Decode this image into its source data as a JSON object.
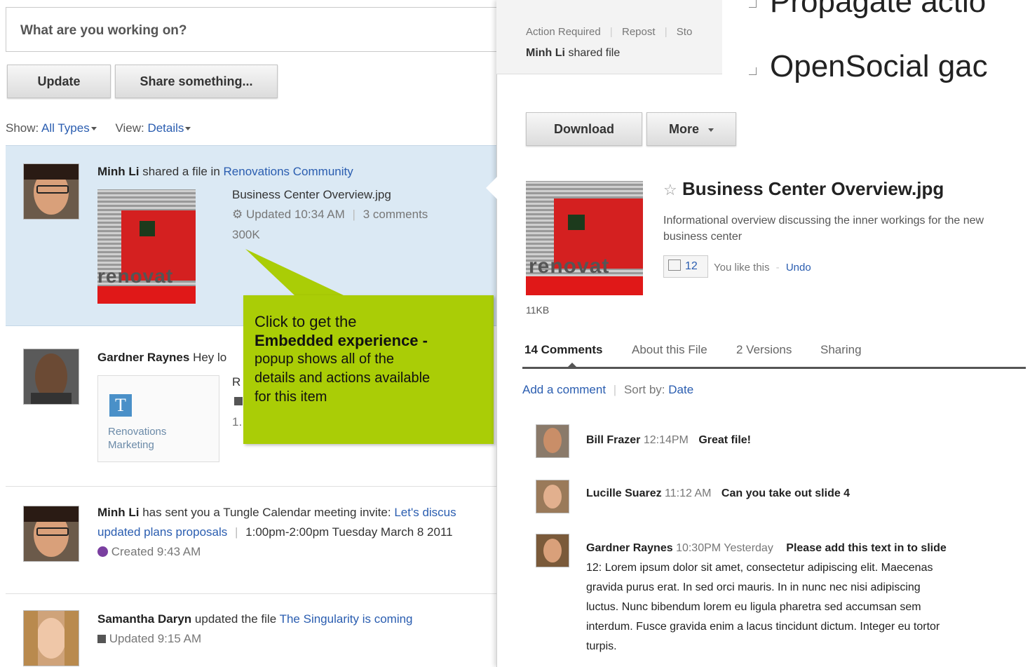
{
  "status": {
    "placeholder": "What are you working on?"
  },
  "buttons": {
    "update": "Update",
    "share": "Share something..."
  },
  "filter": {
    "show_label": "Show:",
    "show_value": "All Types",
    "view_label": "View:",
    "view_value": "Details"
  },
  "feed": {
    "item1": {
      "author": "Minh Li",
      "action": "shared a file in",
      "community": "Renovations Community",
      "file": "Business Center Overview.jpg",
      "updated": "Updated 10:34 AM",
      "comments": "3 comments",
      "size": "300K"
    },
    "item2": {
      "author": "Gardner Raynes",
      "text": "Hey lo",
      "title_frag": "R",
      "size_frag": "1.",
      "card_line1": "Renovations",
      "card_line2": "Marketing"
    },
    "item3": {
      "author": "Minh Li",
      "text": "has sent you a Tungle Calendar meeting invite:",
      "link1": "Let's discus",
      "link2": "updated plans proposals",
      "time": "1:00pm-2:00pm Tuesday March 8 2011",
      "created": "Created 9:43 AM"
    },
    "item4": {
      "author": "Samantha Daryn",
      "action": "updated the file",
      "link": "The Singularity is coming",
      "updated": "Updated 9:15 AM"
    }
  },
  "callout": {
    "line1": "Click to get the",
    "bold": "Embedded experience -",
    "line3": "popup shows all of the",
    "line4": "details and actions available",
    "line5": "for this item"
  },
  "panel": {
    "head_links": [
      "Action Required",
      "Repost",
      "Sto"
    ],
    "head_author": "Minh Li",
    "head_action": "shared file",
    "download": "Download",
    "more": "More",
    "title": "Business Center Overview.jpg",
    "description": "Informational overview discussing the inner workings for the new business center",
    "likes": "12",
    "you_like": "You like this",
    "undo": "Undo",
    "size": "11KB",
    "tabs": [
      "14 Comments",
      "About this File",
      "2 Versions",
      "Sharing"
    ],
    "add_comment": "Add a comment",
    "sort_label": "Sort by:",
    "sort_value": "Date",
    "comments": [
      {
        "author": "Bill Frazer",
        "time": "12:14PM",
        "text": "Great file!"
      },
      {
        "author": "Lucille Suarez",
        "time": "11:12 AM",
        "text": "Can you take out slide 4"
      },
      {
        "author": "Gardner Raynes",
        "time": "10:30PM Yesterday",
        "text": "Please add this text in to slide",
        "body_lines": [
          "12: Lorem ipsum dolor sit amet, consectetur adipiscing elit. Maecenas",
          "gravida purus erat. In sed orci mauris. In in nunc nec nisi adipiscing",
          "luctus. Nunc bibendum lorem eu ligula pharetra sed accumsan sem",
          "interdum. Fusce gravida enim a lacus tincidunt dictum. Integer eu tortor",
          "turpis."
        ]
      }
    ]
  },
  "slide_bullets": [
    "Propagate actio",
    "OpenSocial gac"
  ],
  "thumb_text": "renovat"
}
